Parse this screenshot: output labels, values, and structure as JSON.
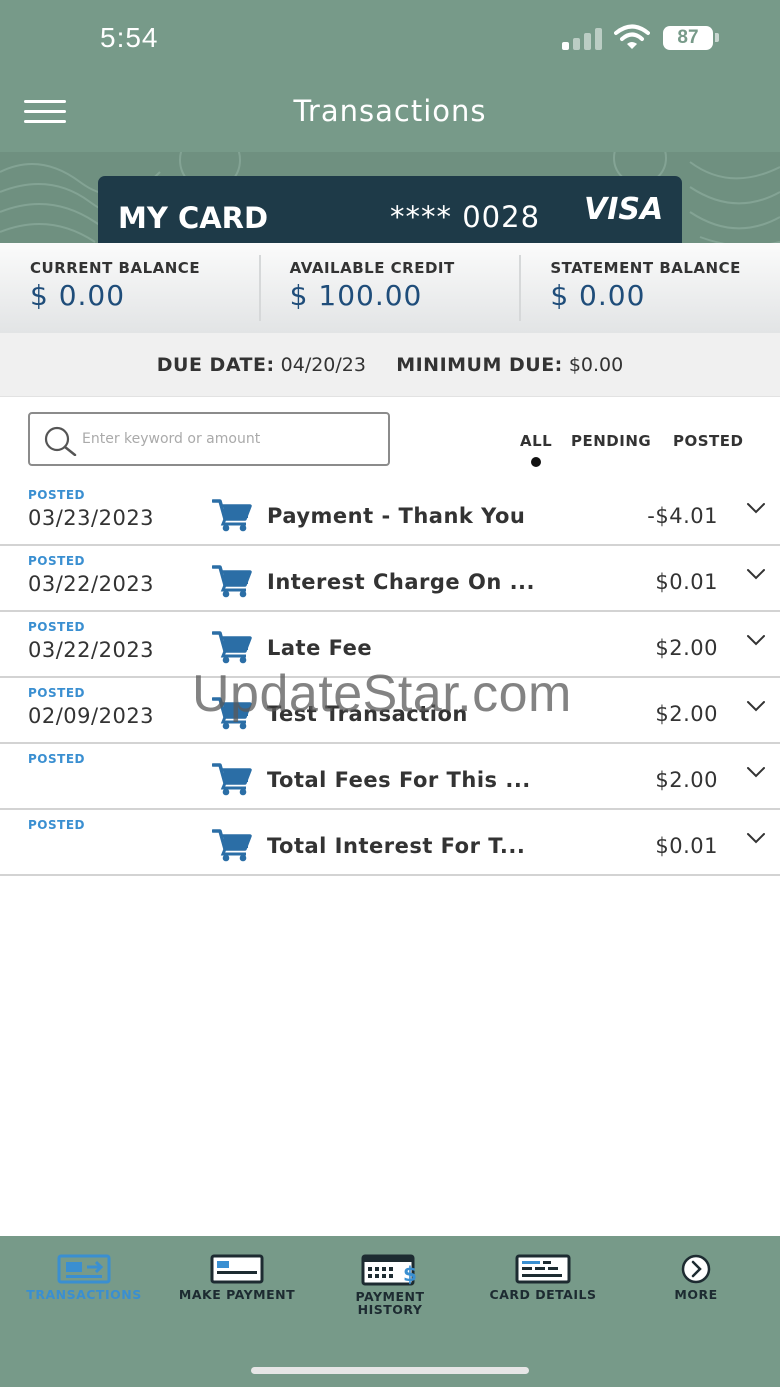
{
  "status_bar": {
    "time": "5:54",
    "battery": "87"
  },
  "header": {
    "title": "Transactions"
  },
  "card": {
    "name": "MY CARD",
    "number": "**** 0028",
    "network": "VISA"
  },
  "balances": [
    {
      "label": "CURRENT BALANCE",
      "value": "$ 0.00"
    },
    {
      "label": "AVAILABLE CREDIT",
      "value": "$ 100.00"
    },
    {
      "label": "STATEMENT BALANCE",
      "value": "$ 0.00"
    }
  ],
  "due": {
    "due_label": "DUE DATE:",
    "due_value": "04/20/23",
    "min_label": "MINIMUM DUE:",
    "min_value": "$0.00"
  },
  "search": {
    "placeholder": "Enter keyword or amount"
  },
  "filters": [
    {
      "label": "ALL",
      "selected": true
    },
    {
      "label": "PENDING",
      "selected": false
    },
    {
      "label": "POSTED",
      "selected": false
    }
  ],
  "transactions": [
    {
      "status": "POSTED",
      "date": "03/23/2023",
      "description": "Payment - Thank You",
      "amount": "-$4.01"
    },
    {
      "status": "POSTED",
      "date": "03/22/2023",
      "description": "Interest Charge On ...",
      "amount": "$0.01"
    },
    {
      "status": "POSTED",
      "date": "03/22/2023",
      "description": "Late Fee",
      "amount": "$2.00"
    },
    {
      "status": "POSTED",
      "date": "02/09/2023",
      "description": "Test Transaction",
      "amount": "$2.00"
    },
    {
      "status": "POSTED",
      "date": "",
      "description": "Total Fees For This ...",
      "amount": "$2.00"
    },
    {
      "status": "POSTED",
      "date": "",
      "description": "Total Interest For T...",
      "amount": "$0.01"
    }
  ],
  "watermark": "UpdateStar.com",
  "bottom_nav": [
    {
      "label": "TRANSACTIONS",
      "icon": "transactions-icon",
      "active": true
    },
    {
      "label": "MAKE PAYMENT",
      "icon": "card-payment-icon",
      "active": false
    },
    {
      "label": "PAYMENT HISTORY",
      "icon": "calendar-dollar-icon",
      "active": false
    },
    {
      "label": "CARD DETAILS",
      "icon": "card-details-icon",
      "active": false
    },
    {
      "label": "MORE",
      "icon": "chevron-right-circle-icon",
      "active": false
    }
  ],
  "colors": {
    "header_bg": "#779a89",
    "card_bg": "#1e3a48",
    "accent_blue": "#3a8fd1",
    "amount_blue": "#1f4d7a",
    "cart_blue": "#2b6ea6"
  }
}
